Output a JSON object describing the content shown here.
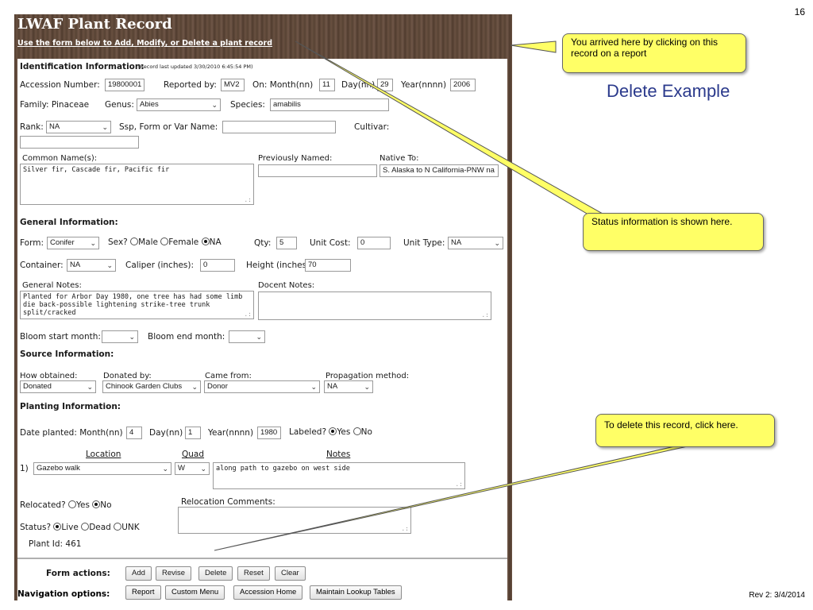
{
  "slide": {
    "page_number": "16",
    "title": "Delete Example",
    "revision": "Rev 2: 3/4/2014",
    "callouts": {
      "arrived": "You arrived here by clicking on this record on a report",
      "status": "Status information is shown here.",
      "delete": "To delete this record, click here."
    }
  },
  "app": {
    "title": "LWAF Plant Record",
    "subtitle_link": "Use the form below to Add, Modify, or Delete a plant record"
  },
  "ident": {
    "heading": "Identification Information:",
    "updated": "(Record last updated 3/30/2010 6:45:54 PM)",
    "accession_label": "Accession Number:",
    "accession_value": "19800001",
    "reported_label": "Reported by:",
    "reported_value": "MV2",
    "on_month_label": "On: Month(nn)",
    "on_month_value": "11",
    "day_label": "Day(nn)",
    "day_value": "29",
    "year_label": "Year(nnnn)",
    "year_value": "2006",
    "family_label": "Family: Pinaceae",
    "genus_label": "Genus:",
    "genus_value": "Abies",
    "species_label": "Species:",
    "species_value": "amabilis",
    "rank_label": "Rank:",
    "rank_value": "NA",
    "ssp_label": "Ssp, Form or Var Name:",
    "ssp_value": "",
    "cultivar_label": "Cultivar:",
    "cultivar_value": "",
    "common_label": "Common Name(s):",
    "common_value": "Silver fir, Cascade fir, Pacific fir",
    "previously_label": "Previously Named:",
    "previously_value": "",
    "native_label": "Native To:",
    "native_value": "S. Alaska to N California-PNW na"
  },
  "general": {
    "heading": "General Information:",
    "form_label": "Form:",
    "form_value": "Conifer",
    "sex_label": "Sex?",
    "male": "Male",
    "female": "Female",
    "na": "NA",
    "qty_label": "Qty:",
    "qty_value": "5",
    "unit_cost_label": "Unit Cost:",
    "unit_cost_value": "0",
    "unit_type_label": "Unit Type:",
    "unit_type_value": "NA",
    "container_label": "Container:",
    "container_value": "NA",
    "caliper_label": "Caliper (inches):",
    "caliper_value": "0",
    "height_label": "Height (inches):",
    "height_value": "70",
    "notes_label": "General Notes:",
    "notes_value": "Planted for Arbor Day 1980, one tree has had some limb die back-possible lightening strike-tree trunk split/cracked",
    "docent_label": "Docent Notes:",
    "docent_value": "",
    "bloom_start_label": "Bloom start month:",
    "bloom_start_value": "",
    "bloom_end_label": "Bloom end month:",
    "bloom_end_value": ""
  },
  "source": {
    "heading": "Source Information:",
    "how_label": "How obtained:",
    "how_value": "Donated",
    "donated_label": "Donated by:",
    "donated_value": "Chinook Garden Clubs",
    "came_label": "Came from:",
    "came_value": "Donor",
    "prop_label": "Propagation method:",
    "prop_value": "NA"
  },
  "planting": {
    "heading": "Planting Information:",
    "date_label": "Date planted: Month(nn)",
    "month_value": "4",
    "day_label": "Day(nn)",
    "day_value": "1",
    "year_label": "Year(nnnn)",
    "year_value": "1980",
    "labeled_label": "Labeled?",
    "yes": "Yes",
    "no": "No",
    "col_location": "Location",
    "col_quad": "Quad",
    "col_notes": "Notes",
    "row_index": "1)",
    "location_value": "Gazebo walk",
    "quad_value": "W",
    "notes_value": "along path to gazebo on west side",
    "relocated_label": "Relocated?",
    "reloc_comments_label": "Relocation Comments:",
    "status_label": "Status?",
    "live": "Live",
    "dead": "Dead",
    "unk": "UNK",
    "plant_id": "Plant Id: 461"
  },
  "actions": {
    "form_actions_label": "Form actions:",
    "add": "Add",
    "revise": "Revise",
    "delete": "Delete",
    "reset": "Reset",
    "clear": "Clear",
    "nav_label": "Navigation options:",
    "report": "Report",
    "custom_menu": "Custom Menu",
    "accession_home": "Accession Home",
    "maintain": "Maintain Lookup Tables"
  },
  "icons": {
    "dropdown": "chevron-down-icon",
    "resize": "resize-grip-icon"
  },
  "colors": {
    "callout_bg": "#ffff66",
    "title_blue": "#2b3a8c",
    "header_wood": "#5b4637"
  }
}
